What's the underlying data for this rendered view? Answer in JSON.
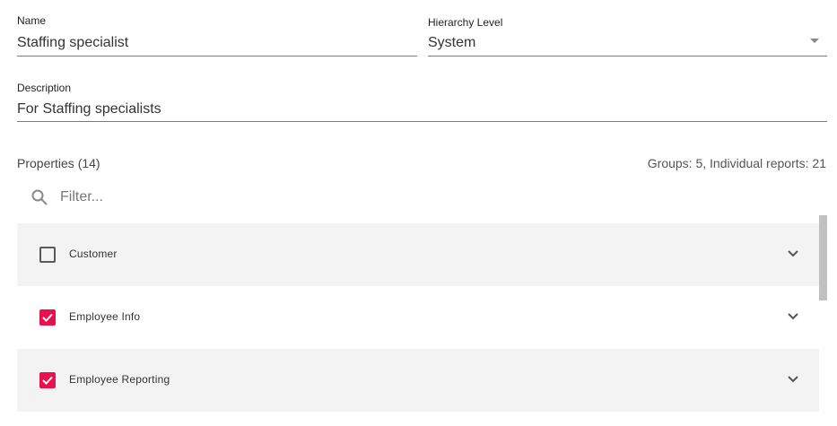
{
  "form": {
    "name_label": "Name",
    "name_value": "Staffing specialist",
    "hierarchy_label": "Hierarchy Level",
    "hierarchy_value": "System",
    "description_label": "Description",
    "description_value": "For Staffing specialists"
  },
  "properties": {
    "title": "Properties (14)",
    "summary": "Groups: 5, Individual reports: 21",
    "filter_placeholder": "Filter...",
    "items": [
      {
        "label": "Customer",
        "checked": false
      },
      {
        "label": "Employee Info",
        "checked": true
      },
      {
        "label": "Employee Reporting",
        "checked": true
      }
    ]
  },
  "icons": {
    "search": "search-icon",
    "chevron": "chevron-down-icon",
    "dropdown": "dropdown-arrow-icon",
    "check": "checkmark-icon"
  },
  "colors": {
    "accent": "#e8114e",
    "row_alt": "#f3f3f3",
    "underline": "#7a7a7a"
  }
}
